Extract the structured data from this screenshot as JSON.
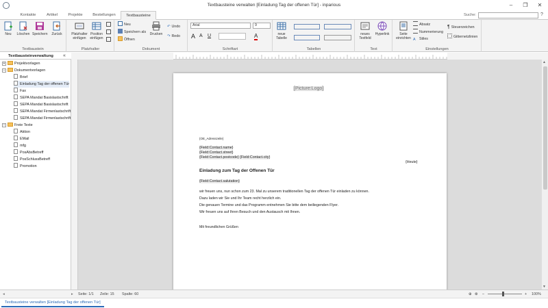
{
  "window": {
    "title": "Textbausteine verwalten [Einladung Tag der offenen Tür] - inparious",
    "minimize": "–",
    "restore": "❐",
    "close": "✕"
  },
  "tabs": [
    {
      "label": "Kontakte"
    },
    {
      "label": "Artikel"
    },
    {
      "label": "Projekte"
    },
    {
      "label": "Bestellungen"
    },
    {
      "label": "Textbausteine",
      "active": true
    }
  ],
  "search": {
    "label": "Suche:",
    "value": "",
    "help": "?"
  },
  "ribbon": {
    "textbaustein": {
      "label": "Textbaustein",
      "new": "Neu",
      "delete": "Löschen",
      "save": "Speichern",
      "back": "Zurück"
    },
    "platzhalter": {
      "label": "Platzhalter",
      "insert_placeholder": "Platzhalter einfügen",
      "insert_position": "Position einfügen"
    },
    "dokument": {
      "label": "Dokument",
      "new": "Neu",
      "save_as": "Speichern als",
      "open": "Öffnen",
      "print": "Drucken",
      "undo": "Undo",
      "redo": "Redo"
    },
    "schriftart": {
      "label": "Schriftart",
      "font": "Arial",
      "size": "9",
      "grow": "A",
      "shrink": "A",
      "clear": "A",
      "bold": "B",
      "italic": "I",
      "underline": "U",
      "color_marker": "A"
    },
    "tabellen": {
      "label": "Tabellen",
      "new_table": "neue Tabelle"
    },
    "text": {
      "label": "Text",
      "new_textfield": "neues Textfeld",
      "hyperlink": "Hyperlink"
    },
    "einstellungen": {
      "label": "Einstellungen",
      "page_setup": "Seite einrichten",
      "paragraph": "Absatz",
      "numbering": "Nummerierung",
      "styles": "Stiles",
      "control_chars": "Steuerzeichen",
      "gridlines": "Gitternetzlinien"
    }
  },
  "left_panel": {
    "title": "Textbausteinverwaltung",
    "collapse": "«",
    "tree": [
      {
        "label": "Projektvorlagen",
        "type": "folder",
        "expander": "+",
        "level": 0
      },
      {
        "label": "Dokumentvorlagen",
        "type": "folder",
        "expander": "–",
        "level": 0
      },
      {
        "label": "Brief",
        "type": "doc",
        "level": 1
      },
      {
        "label": "Einladung Tag der offenen Tür",
        "type": "doc",
        "level": 1,
        "selected": true
      },
      {
        "label": "Fax",
        "type": "doc",
        "level": 1
      },
      {
        "label": "SEPA Mandat Basislastschrift",
        "type": "doc",
        "level": 1
      },
      {
        "label": "SEPA Mandat Basislastschrift",
        "type": "doc",
        "level": 1
      },
      {
        "label": "SEPA Mandat Firmenlastschrift",
        "type": "doc",
        "level": 1
      },
      {
        "label": "SEPA Mandat Firmenlastschrift",
        "type": "doc",
        "level": 1
      },
      {
        "label": "Freie Texte",
        "type": "folder",
        "expander": "–",
        "level": 0
      },
      {
        "label": "Aktion",
        "type": "doc",
        "level": 1
      },
      {
        "label": "EMail",
        "type": "doc",
        "level": 1
      },
      {
        "label": "mfg",
        "type": "doc",
        "level": 1
      },
      {
        "label": "PosAbsBetreff",
        "type": "doc",
        "level": 1
      },
      {
        "label": "PosSchlussBetreff",
        "type": "doc",
        "level": 1
      },
      {
        "label": "Promotion",
        "type": "doc",
        "level": 1
      }
    ]
  },
  "document": {
    "logo": "[Picture:Logo]",
    "sender_line": "{OE_Adresszeile}",
    "name": "{Field:Contact.name}",
    "street": "{Field:Contact.street}",
    "city": "{Field:Contact.postcode} {Field:Contact.city}",
    "date": "{Heute}",
    "heading": "Einladung zum Tag der Offenen Tür",
    "salutation": "{Field:Contact.salutation}",
    "body1": "wir freuen uns, nun schon zum 23. Mal zu unserem traditionellen Tag der offenen Tür einladen zu können.",
    "body2": "Dazu laden wir Sie und Ihr Team recht herzlich ein.",
    "body3": "Die genauen Termine und das Programm entnehmen Sie bitte dem beiliegenden Flyer.",
    "body4": "Wir freuen uns auf Ihren Besuch und den Austausch mit Ihnen.",
    "closing": "Mit freundlichen Grüßen"
  },
  "status": {
    "page": "Seite: 1/1",
    "line": "Zeile: 15",
    "column": "Spalte: 60",
    "zoom": "100%",
    "zoom_minus": "–",
    "zoom_plus": "+"
  },
  "taskbar": {
    "active_window": "Textbausteine verwalten [Einladung Tag der offenen Tür]"
  }
}
